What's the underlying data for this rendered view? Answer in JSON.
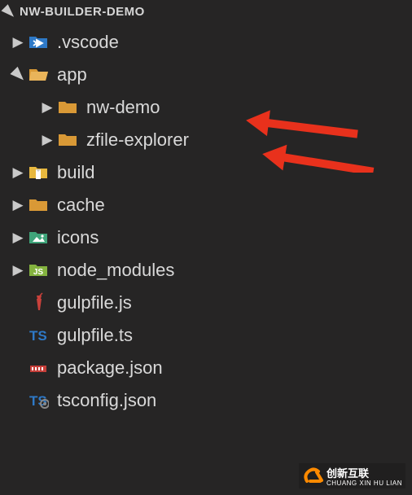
{
  "header": {
    "title": "NW-BUILDER-DEMO"
  },
  "tree": {
    "items": [
      {
        "label": ".vscode",
        "indent": 1,
        "chevron": "collapsed",
        "icon": "vscode-folder"
      },
      {
        "label": "app",
        "indent": 1,
        "chevron": "expanded",
        "icon": "folder-open"
      },
      {
        "label": "nw-demo",
        "indent": 2,
        "chevron": "collapsed",
        "icon": "folder"
      },
      {
        "label": "zfile-explorer",
        "indent": 2,
        "chevron": "collapsed",
        "icon": "folder"
      },
      {
        "label": "build",
        "indent": 1,
        "chevron": "collapsed",
        "icon": "build-folder"
      },
      {
        "label": "cache",
        "indent": 1,
        "chevron": "collapsed",
        "icon": "folder"
      },
      {
        "label": "icons",
        "indent": 1,
        "chevron": "collapsed",
        "icon": "image-folder"
      },
      {
        "label": "node_modules",
        "indent": 1,
        "chevron": "collapsed",
        "icon": "node-folder"
      },
      {
        "label": "gulpfile.js",
        "indent": 1,
        "chevron": "none",
        "icon": "gulp"
      },
      {
        "label": "gulpfile.ts",
        "indent": 1,
        "chevron": "none",
        "icon": "ts"
      },
      {
        "label": "package.json",
        "indent": 1,
        "chevron": "none",
        "icon": "npm"
      },
      {
        "label": "tsconfig.json",
        "indent": 1,
        "chevron": "none",
        "icon": "tsconfig"
      }
    ]
  },
  "watermark": {
    "brand": "创新互联",
    "sub": "CHUANG XIN HU LIAN"
  },
  "colors": {
    "folder": "#D99936",
    "ts": "#2E79C7",
    "npm": "#C63F3A",
    "gulp": "#C9413B",
    "node": "#84B33F",
    "image": "#3FA47A",
    "build": "#E8B83E",
    "vscode": "#2E79C7",
    "arrow": "#E8311C"
  }
}
